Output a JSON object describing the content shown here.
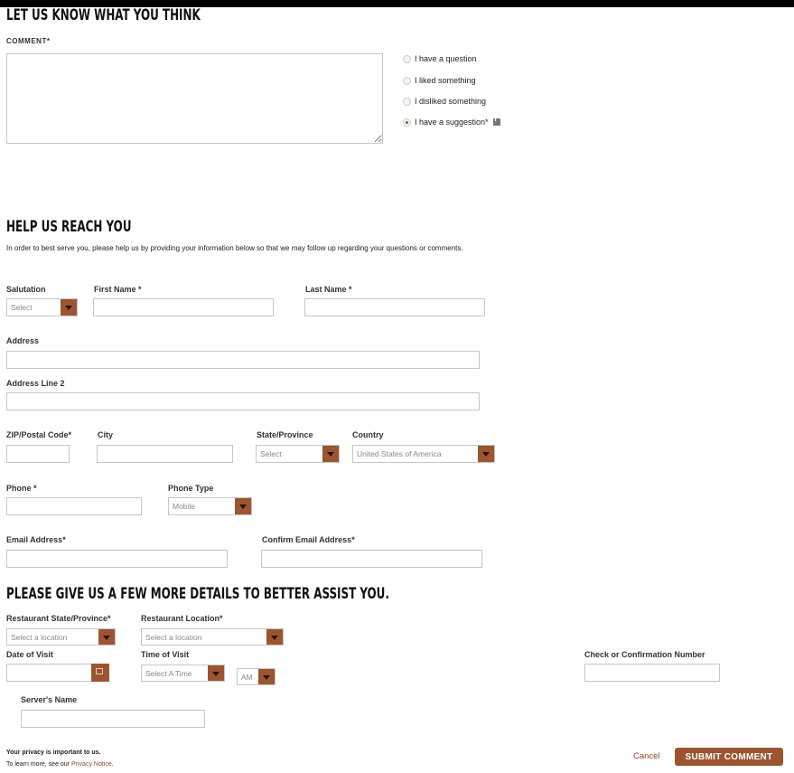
{
  "sections": {
    "feedback_title": "LET US KNOW WHAT YOU THINK",
    "reach_title": "HELP US REACH YOU",
    "reach_intro": "In order to best serve you, please help us by providing your information below so that we may follow up regarding your questions or comments.",
    "details_title": "PLEASE GIVE US A FEW MORE DETAILS TO BETTER ASSIST YOU."
  },
  "comment": {
    "label": "COMMENT*",
    "value": "",
    "options": [
      {
        "label": "I have a question",
        "selected": false
      },
      {
        "label": "I liked something",
        "selected": false
      },
      {
        "label": "I disliked something",
        "selected": false
      },
      {
        "label": "I have a suggestion*",
        "selected": true
      }
    ]
  },
  "contact": {
    "salutation_label": "Salutation",
    "salutation_value": "Select",
    "first_name_label": "First Name *",
    "last_name_label": "Last Name *",
    "address_label": "Address",
    "address2_label": "Address Line 2",
    "zip_label": "ZIP/Postal Code*",
    "city_label": "City",
    "state_label": "State/Province",
    "state_value": "Select",
    "country_label": "Country",
    "country_value": "United States of America",
    "phone_label": "Phone *",
    "phone_type_label": "Phone Type",
    "phone_type_value": "Mobile",
    "email_label": "Email Address*",
    "confirm_email_label": "Confirm Email Address*"
  },
  "details": {
    "restaurant_state_label": "Restaurant State/Province*",
    "restaurant_state_value": "Select a location",
    "restaurant_location_label": "Restaurant Location*",
    "restaurant_location_value": "Select a location",
    "date_label": "Date of Visit",
    "time_label": "Time of Visit",
    "time_value": "Select A Time",
    "ampm_value": "AM",
    "check_label": "Check or Confirmation Number",
    "server_label": "Server's Name"
  },
  "footer": {
    "privacy_line1": "Your privacy is important to us.",
    "privacy_line2": "To learn more, see our",
    "privacy_link": "Privacy Notice",
    "privacy_end": ".",
    "cancel_label": "Cancel",
    "submit_label": "SUBMIT COMMENT"
  },
  "colors": {
    "accent": "#9c5530",
    "border": "#c6c6c6",
    "top_bar": "#000000"
  }
}
